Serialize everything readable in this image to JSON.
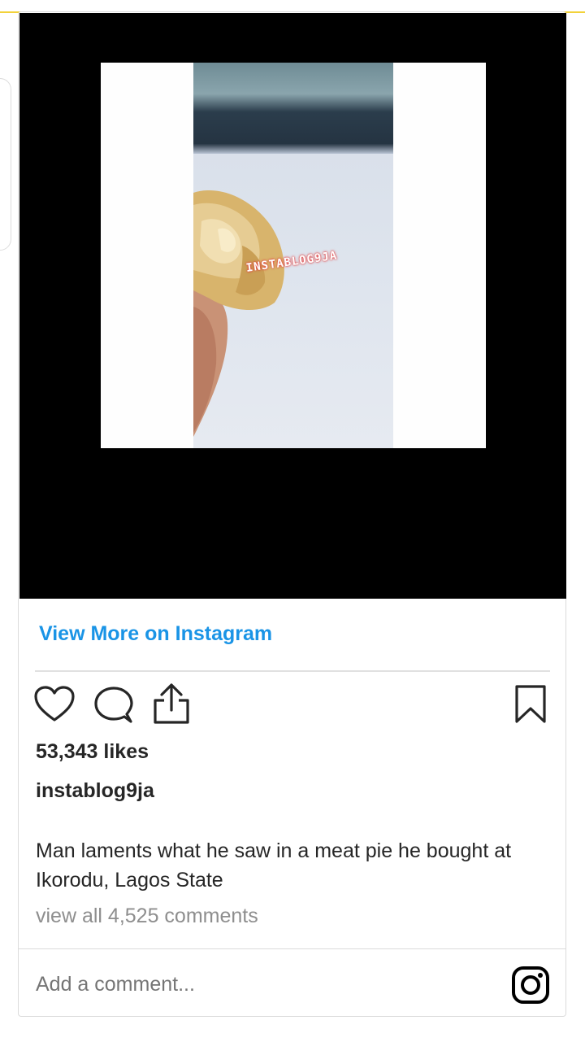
{
  "post": {
    "watermark": "INSTABLOG9JA",
    "view_more_label": "View More on Instagram",
    "likes": "53,343 likes",
    "username": "instablog9ja",
    "caption": "Man laments what he saw in a meat pie he bought at Ikorodu, Lagos State",
    "view_comments": "view all 4,525 comments",
    "comment_placeholder": "Add a comment..."
  },
  "icons": {
    "like": "heart-icon",
    "comment": "speech-bubble-icon",
    "share": "share-upload-icon",
    "save": "bookmark-icon",
    "brand": "instagram-logo-icon"
  },
  "colors": {
    "link_blue": "#1a94e6",
    "text_dark": "#262626",
    "text_muted": "#8e8e8e",
    "accent_yellow": "#f2d23a"
  }
}
